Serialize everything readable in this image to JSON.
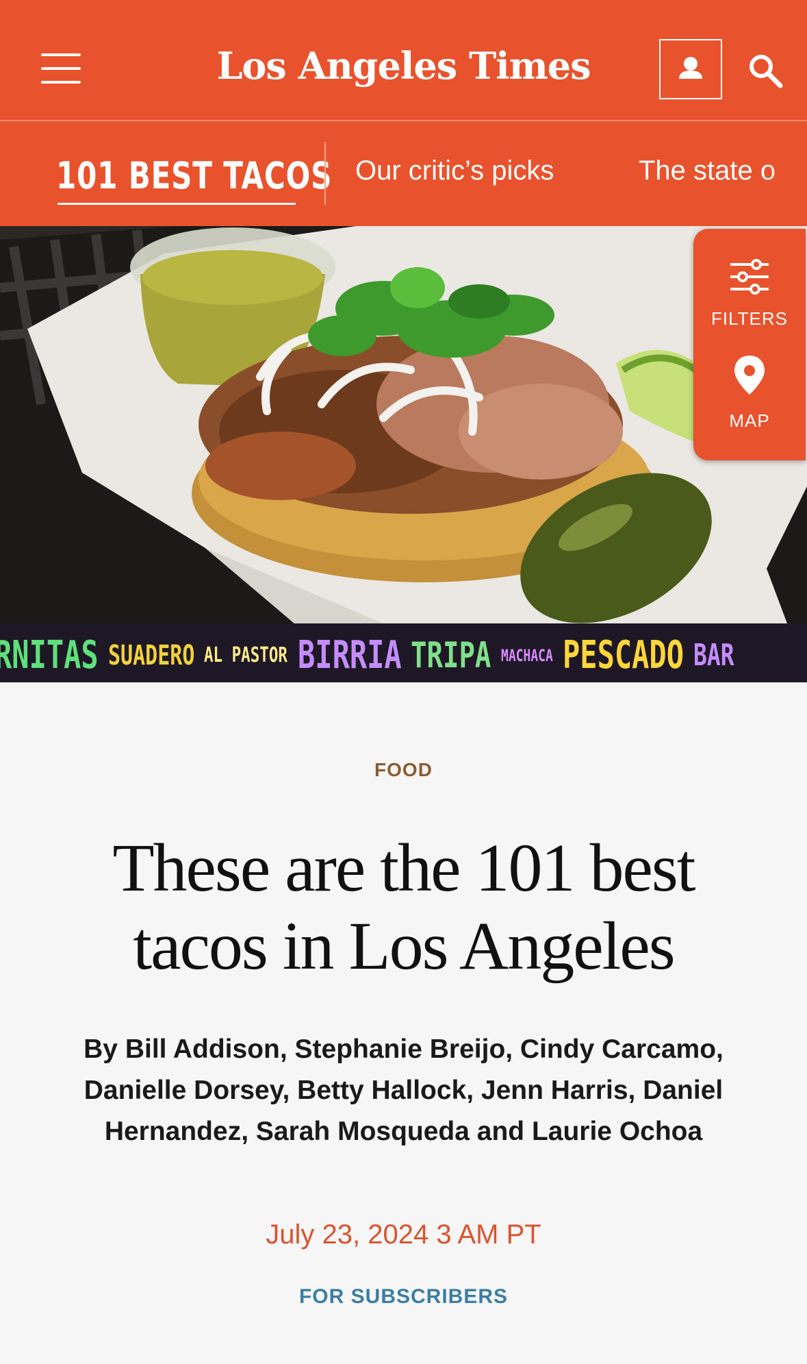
{
  "header": {
    "logo": "Los Angeles Times",
    "menu_icon": "hamburger-menu-icon",
    "account_icon": "user-icon",
    "search_icon": "search-icon",
    "brand_color": "#e8522d"
  },
  "subnav": {
    "brand": "101 BEST TACOS",
    "links": [
      "Our critic’s picks",
      "The state o"
    ]
  },
  "hero": {
    "strip_words": [
      {
        "text": "RNITAS",
        "color": "#5ee07a"
      },
      {
        "text": "SUADERO",
        "color": "#f2d23a"
      },
      {
        "text": "AL PASTOR",
        "color": "#ffe98a"
      },
      {
        "text": "BIRRIA",
        "color": "#c58cff"
      },
      {
        "text": "TRIPA",
        "color": "#7fe08b"
      },
      {
        "text": "MACHACA",
        "color": "#d68cff"
      },
      {
        "text": "PESCADO",
        "color": "#ffd63a"
      },
      {
        "text": "BAR",
        "color": "#c58cff"
      }
    ]
  },
  "side_panel": {
    "filters_label": "FILTERS",
    "filters_icon": "sliders-icon",
    "map_label": "MAP",
    "map_icon": "map-pin-icon"
  },
  "article": {
    "kicker": "FOOD",
    "headline": "These are the 101 best tacos in Los Angeles",
    "byline": "By Bill Addison, Stephanie Breijo, Cindy Carcamo, Danielle Dorsey, Betty Hallock, Jenn Harris, Daniel Hernandez, Sarah Mosqueda and Laurie Ochoa",
    "date": "July 23, 2024 3 AM PT",
    "access_label": "FOR SUBSCRIBERS"
  }
}
